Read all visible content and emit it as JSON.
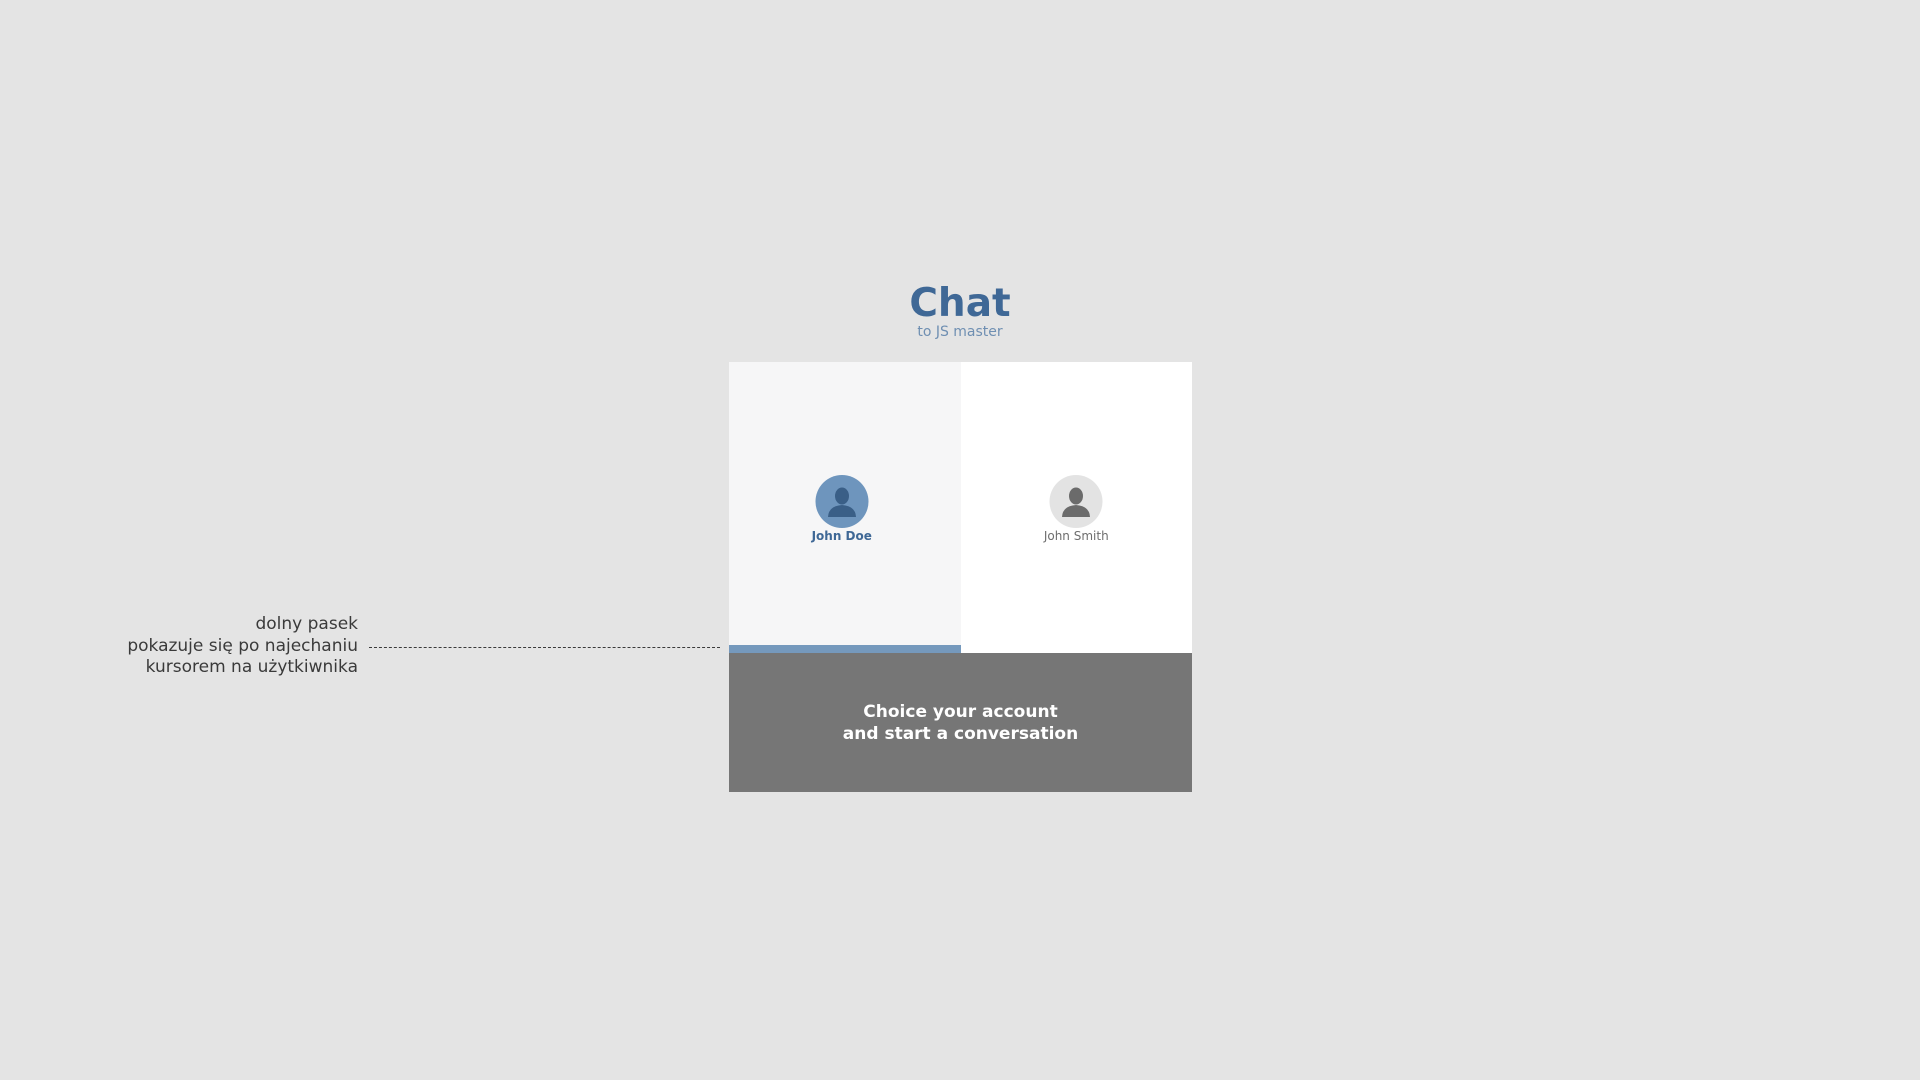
{
  "header": {
    "title": "Chat",
    "subtitle": "to JS master"
  },
  "users": [
    {
      "name": "John Doe",
      "icon": "user-icon",
      "state": "hovered"
    },
    {
      "name": "John Smith",
      "icon": "user-icon",
      "state": "default"
    }
  ],
  "footer": {
    "line1": "Choice your account",
    "line2": "and start a conversation"
  },
  "annotation": {
    "line1": "dolny pasek",
    "line2": "pokazuje się po najechaniu",
    "line3": "kursorem na użytkiwnika"
  },
  "colors": {
    "background": "#e4e4e4",
    "accent": "#3f6896",
    "hover_bar": "#7599bd",
    "footer": "#767676"
  }
}
